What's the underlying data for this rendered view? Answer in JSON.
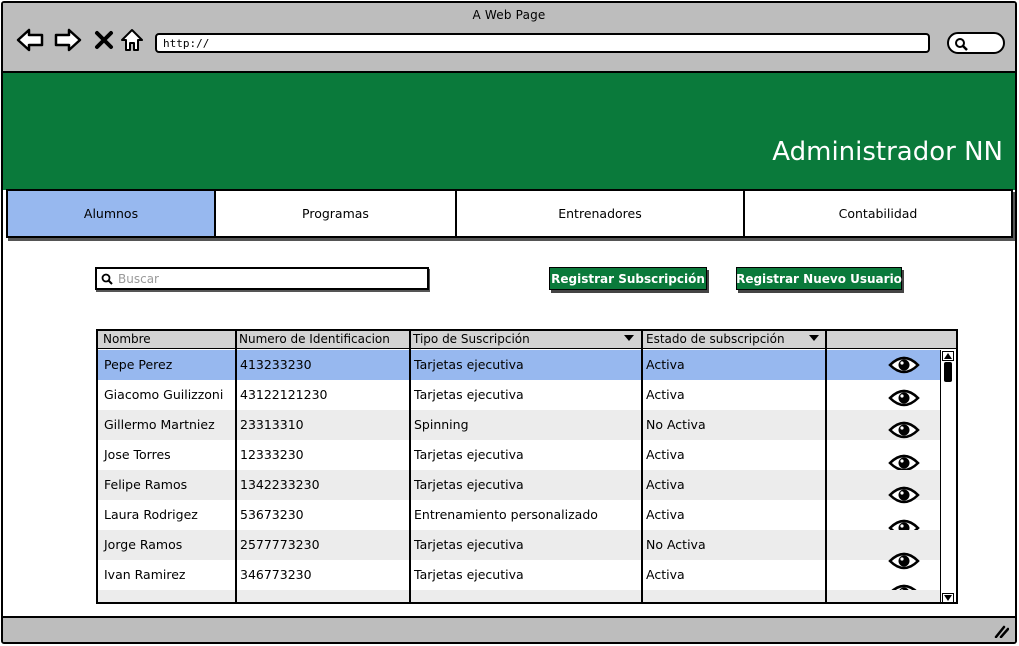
{
  "window": {
    "title": "A Web Page"
  },
  "browser": {
    "url": "http://",
    "icons": [
      "back-icon",
      "forward-icon",
      "close-icon",
      "home-icon",
      "search-icon"
    ]
  },
  "header": {
    "title": "Administrador NN",
    "color": "#0a7a3b"
  },
  "tabs": [
    {
      "label": "Alumnos",
      "active": true
    },
    {
      "label": "Programas",
      "active": false
    },
    {
      "label": "Entrenadores",
      "active": false
    },
    {
      "label": "Contabilidad",
      "active": false
    }
  ],
  "search": {
    "placeholder": "Buscar",
    "value": ""
  },
  "actions": {
    "register_subscription": "Registrar Subscripción",
    "register_user": "Registrar Nuevo Usuario"
  },
  "table": {
    "columns": [
      "Nombre",
      "Numero de Identificacion",
      "Tipo de Suscripción",
      "Estado de subscripción",
      ""
    ],
    "rows": [
      {
        "nombre": "Pepe Perez",
        "id": "413233230",
        "tipo": "Tarjetas ejecutiva",
        "estado": "Activa",
        "selected": true
      },
      {
        "nombre": "Giacomo Guilizzoni",
        "id": "43122121230",
        "tipo": "Tarjetas ejecutiva",
        "estado": "Activa"
      },
      {
        "nombre": "Gillermo Martniez",
        "id": "23313310",
        "tipo": " Spinning",
        "estado": "No Activa"
      },
      {
        "nombre": "Jose Torres",
        "id": "12333230",
        "tipo": "Tarjetas ejecutiva",
        "estado": "Activa"
      },
      {
        "nombre": "Felipe Ramos",
        "id": "1342233230",
        "tipo": "Tarjetas ejecutiva",
        "estado": "Activa"
      },
      {
        "nombre": "Laura Rodrigez",
        "id": "53673230",
        "tipo": "Entrenamiento personalizado",
        "estado": "Activa"
      },
      {
        "nombre": "Jorge Ramos",
        "id": "2577773230",
        "tipo": "Tarjetas ejecutiva",
        "estado": "No Activa"
      },
      {
        "nombre": "Ivan Ramirez",
        "id": "346773230",
        "tipo": " Tarjetas ejecutiva",
        "estado": "Activa"
      },
      {
        "nombre": "",
        "id": "",
        "tipo": "",
        "estado": ""
      }
    ],
    "row_icon": "eye-icon",
    "selected_color": "#97b8ef",
    "alt_color": "#ececec"
  }
}
